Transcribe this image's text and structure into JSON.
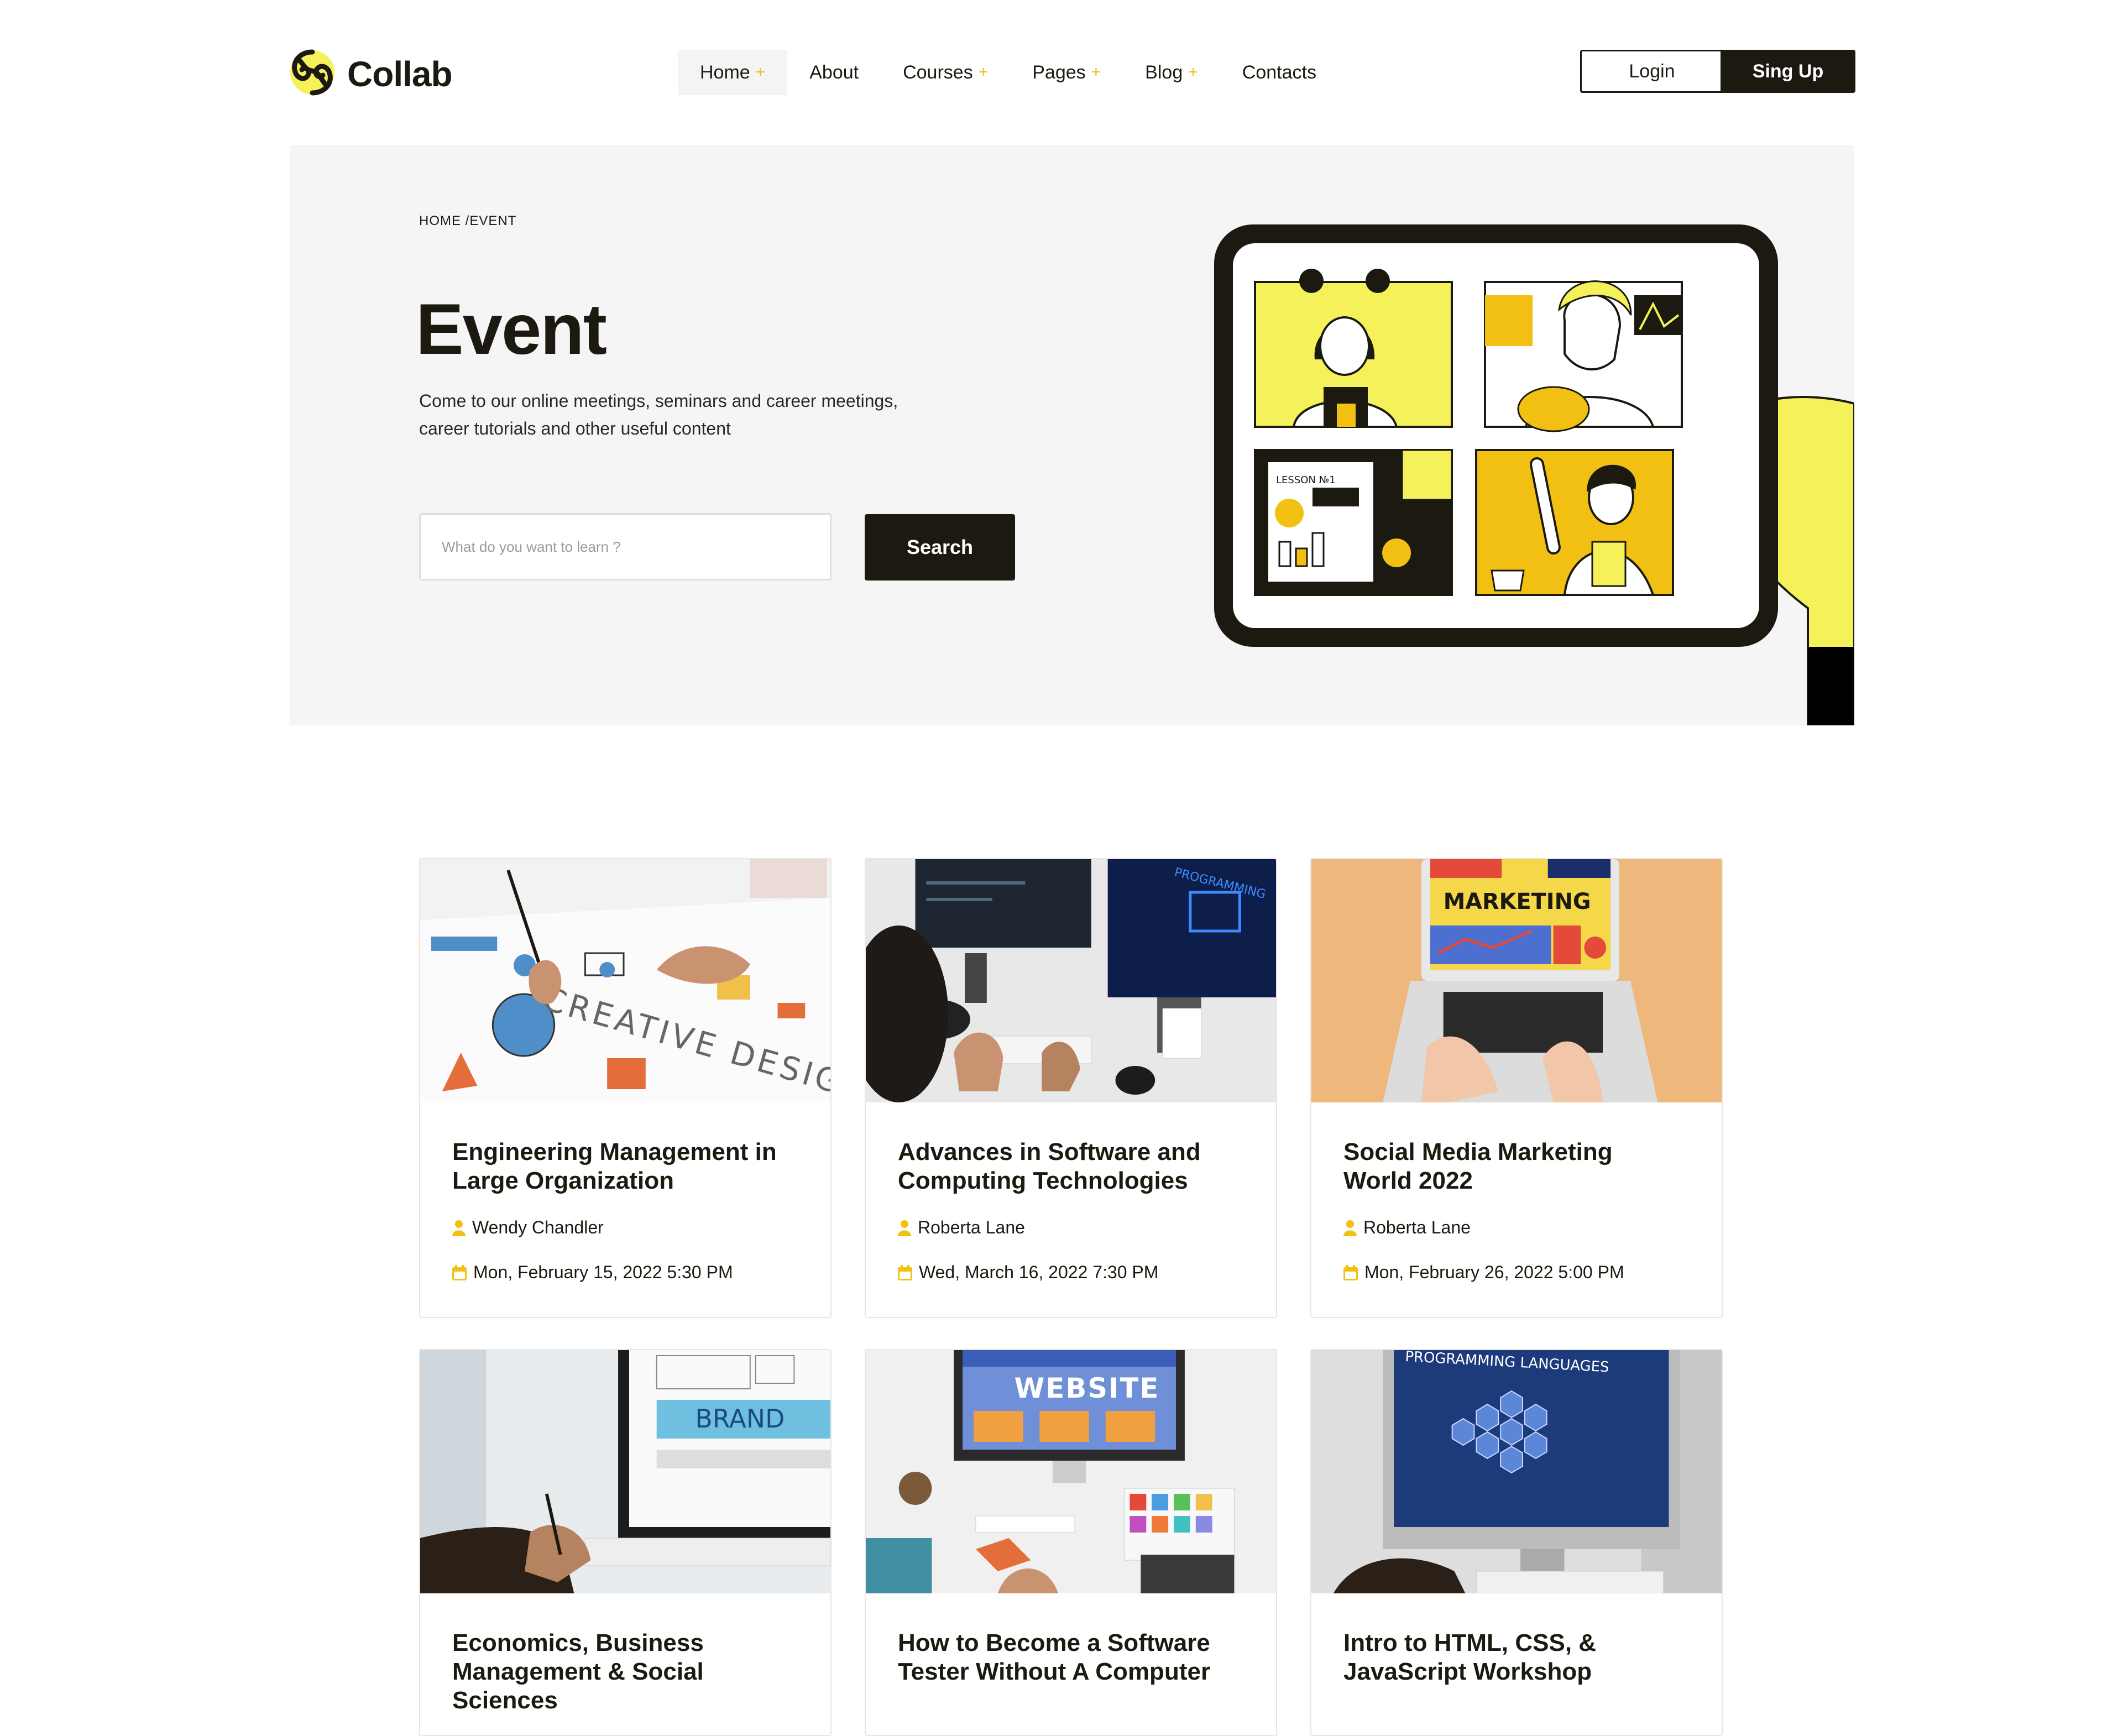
{
  "header": {
    "brand": "Collab",
    "nav": [
      {
        "label": "Home",
        "has_submenu": true,
        "active": true
      },
      {
        "label": "About",
        "has_submenu": false
      },
      {
        "label": "Courses",
        "has_submenu": true
      },
      {
        "label": "Pages",
        "has_submenu": true
      },
      {
        "label": "Blog",
        "has_submenu": true
      },
      {
        "label": "Contacts",
        "has_submenu": false
      }
    ],
    "submenu_marker": "+",
    "login_label": "Login",
    "signup_label": "Sing Up"
  },
  "hero": {
    "breadcrumb": "HOME /EVENT",
    "title": "Event",
    "description_line1": "Come to our online meetings, seminars and career meetings,",
    "description_line2": "career tutorials and other useful content",
    "search_placeholder": "What do you want to learn ?",
    "search_button": "Search",
    "illustration_lesson_label": "LESSON №1"
  },
  "events": [
    {
      "title_line1": "Engineering Management in",
      "title_line2": "Large Organization",
      "author": "Wendy Chandler",
      "date": "Mon, February 15, 2022 5:30 PM",
      "image_text": "CREATIVE DESIGN"
    },
    {
      "title_line1": "Advances in Software and",
      "title_line2": "Computing Technologies",
      "author": "Roberta Lane",
      "date": "Wed, March 16, 2022 7:30 PM",
      "image_text": "PROGRAMMING"
    },
    {
      "title_line1": "Social Media Marketing",
      "title_line2": "World 2022",
      "author": "Roberta Lane",
      "date": "Mon, February 26, 2022 5:00 PM",
      "image_text": "MARKETING"
    },
    {
      "title_line1": "Economics, Business",
      "title_line2": "Management & Social Sciences",
      "image_text": "BRAND"
    },
    {
      "title_line1": "How to Become a Software",
      "title_line2": "Tester Without A Computer",
      "image_text": "WEBSITE"
    },
    {
      "title_line1": "Intro to HTML, CSS, &",
      "title_line2": "JavaScript Workshop",
      "image_text": "PROGRAMMING LANGUAGES"
    }
  ],
  "icons": {
    "author": "user-icon",
    "date": "calendar-icon",
    "logo": "collab-logo-icon"
  },
  "colors": {
    "accent": "#f2c012",
    "dark": "#1c1a10",
    "hero_bg": "#f5f5f5",
    "illustration_yellow": "#f4f15a"
  }
}
